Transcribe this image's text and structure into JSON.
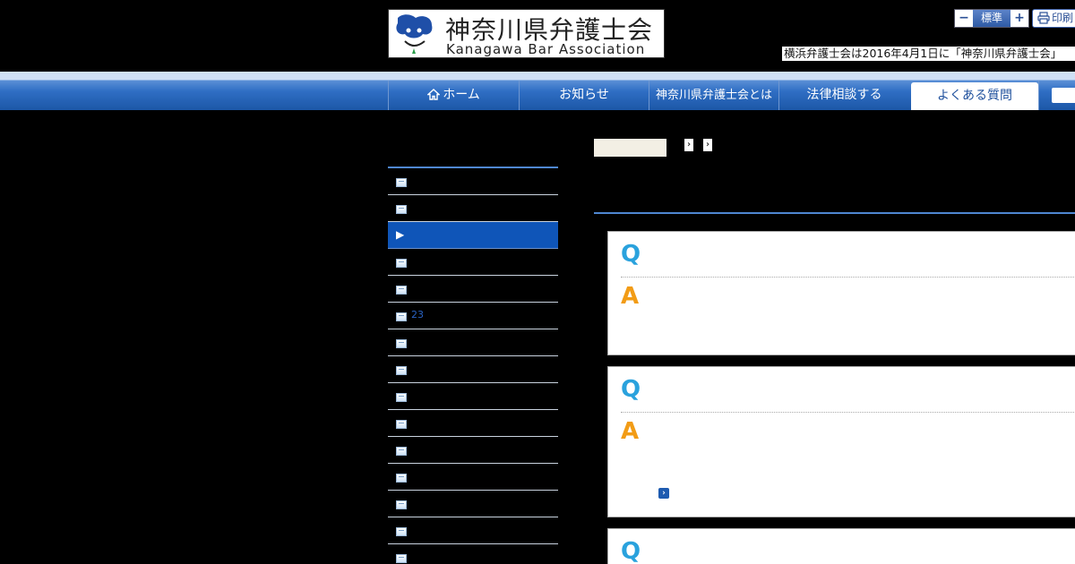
{
  "header": {
    "logo_title_jp": "神奈川県弁護士会",
    "logo_title_en": "Kanagawa Bar Association",
    "font_size_minus": "−",
    "font_size_label": "標準",
    "font_size_plus": "+",
    "print_label": "印刷",
    "notice": "横浜弁護士会は2016年4月1日に「神奈川県弁護士会」"
  },
  "nav": {
    "items": [
      {
        "label": "ホーム",
        "icon": "home-icon"
      },
      {
        "label": "お知らせ"
      },
      {
        "label": "神奈川県弁護士会とは"
      },
      {
        "label": "法律相談する"
      },
      {
        "label": "よくある質問",
        "active": true
      }
    ]
  },
  "breadcrumb": {
    "sep": "›"
  },
  "sidebar": {
    "items": [
      {
        "label": ""
      },
      {
        "label": ""
      },
      {
        "label": "",
        "active": true
      },
      {
        "label": ""
      },
      {
        "label": ""
      },
      {
        "label": "23"
      },
      {
        "label": ""
      },
      {
        "label": ""
      },
      {
        "label": ""
      },
      {
        "label": ""
      },
      {
        "label": ""
      },
      {
        "label": ""
      },
      {
        "label": ""
      },
      {
        "label": ""
      },
      {
        "label": ""
      }
    ]
  },
  "qa": {
    "q_mark": "Q",
    "a_mark": "A",
    "more_icon": "›"
  },
  "colors": {
    "nav_blue": "#1d58a8",
    "active_side": "#0f55b8",
    "q_color": "#2aa2dd",
    "a_color": "#f29c16"
  }
}
